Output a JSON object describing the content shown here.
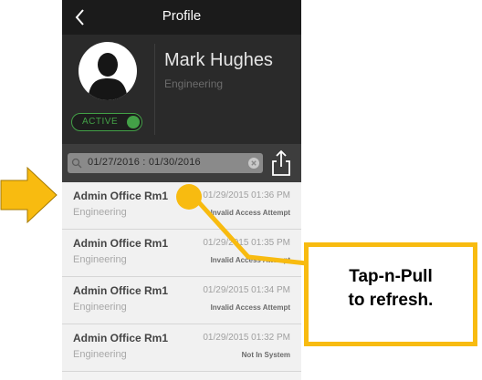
{
  "header": {
    "title": "Profile",
    "back_icon": "chevron-left-icon"
  },
  "profile": {
    "name": "Mark Hughes",
    "department": "Engineering",
    "status_label": "ACTIVE",
    "status_on": true,
    "avatar_icon": "person-silhouette-icon"
  },
  "search": {
    "value": "01/27/2016 : 01/30/2016",
    "search_icon": "search-icon",
    "clear_icon": "clear-circle-icon",
    "share_icon": "share-icon"
  },
  "events": [
    {
      "location": "Admin Office Rm1",
      "department": "Engineering",
      "time": "01/29/2015 01:36 PM",
      "event": "Invalid Access Attempt"
    },
    {
      "location": "Admin Office Rm1",
      "department": "Engineering",
      "time": "01/29/2015 01:35 PM",
      "event": "Invalid Access Attempt"
    },
    {
      "location": "Admin Office Rm1",
      "department": "Engineering",
      "time": "01/29/2015 01:34 PM",
      "event": "Invalid Access Attempt"
    },
    {
      "location": "Admin Office Rm1",
      "department": "Engineering",
      "time": "01/29/2015 01:32 PM",
      "event": "Not In System"
    }
  ],
  "callout": {
    "line1": "Tap-n-Pull",
    "line2": "to refresh."
  },
  "colors": {
    "accent": "#43a047",
    "annotation": "#f8bb10",
    "topbar": "#1b1b1b",
    "profile_bg": "#2a2a2a"
  }
}
